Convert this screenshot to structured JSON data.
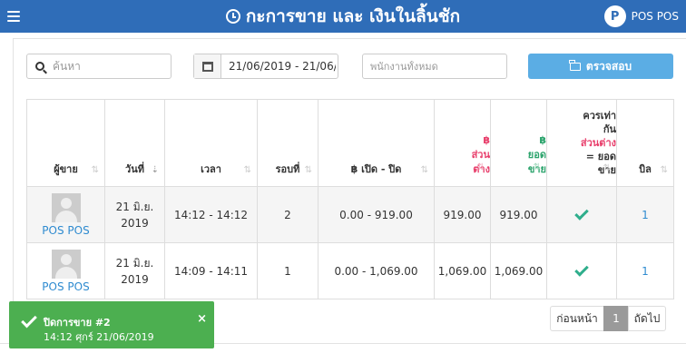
{
  "header": {
    "title": "กะการขาย และ เงินในลิ้นชัก",
    "brand_name": "POS POS",
    "brand_logo_letter": "P",
    "bg_color": "#2f6db8"
  },
  "filters": {
    "search_placeholder": "ค้นหา",
    "date_range": "21/06/2019 - 21/06/2019",
    "staff_placeholder": "พนักงานทั้งหมด",
    "check_button": "ตรวจสอบ"
  },
  "table": {
    "headers": {
      "seller": "ผู้ขาย",
      "date": "วันที่",
      "time": "เวลา",
      "round": "รอบที่",
      "open_close": "฿ เปิด - ปิด",
      "diff_symbol": "฿",
      "diff_label_1": "ส่วน",
      "diff_label_2": "ต่าง",
      "sales_symbol": "฿",
      "sales_label_1": "ยอด",
      "sales_label_2": "ขาย",
      "should_equal_1": "ควรเท่า",
      "should_equal_2": "กัน",
      "should_equal_3": "ส่วนต่าง",
      "should_equal_4": "= ยอด",
      "should_equal_5": "ขาย",
      "bill": "บิล"
    },
    "rows": [
      {
        "seller": "POS POS",
        "date_1": "21 มิ.ย.",
        "date_2": "2019",
        "time": "14:12 - 14:12",
        "round": "2",
        "open_close": "0.00 - 919.00",
        "diff": "919.00",
        "sales": "919.00",
        "bill": "1"
      },
      {
        "seller": "POS POS",
        "date_1": "21 มิ.ย.",
        "date_2": "2019",
        "time": "14:09 - 14:11",
        "round": "1",
        "open_close": "0.00 - 1,069.00",
        "diff": "1,069.00",
        "sales": "1,069.00",
        "bill": "1"
      }
    ]
  },
  "pager": {
    "prev": "ก่อนหน้า",
    "current": "1",
    "next": "ถัดไป"
  },
  "toast": {
    "title": "ปิดการขาย #2",
    "subtitle": "14:12 ศุกร์ 21/06/2019",
    "close": "×"
  }
}
